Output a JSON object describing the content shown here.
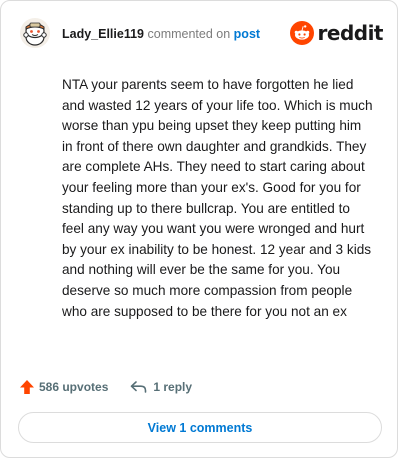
{
  "header": {
    "username": "Lady_Ellie119",
    "action": "commented on",
    "post_link": "post",
    "brand": "reddit",
    "avatar_icon": "snoo-avatar-icon",
    "logo_icon": "reddit-alien-icon"
  },
  "comment": {
    "text": "NTA your parents seem to have forgotten he lied and wasted 12 years of your life too. Which is much worse than ypu being upset they keep putting him in front of there own daughter and grandkids. They are complete AHs. They need to start caring about your feeling more than your ex's. Good for you for standing up to there bullcrap. You are entitled to feel any way you want you were wronged and hurt by your ex inability to be honest. 12 year and 3 kids and nothing will ever be the same for you. You deserve so much more compassion from people who are supposed to be there for you not an ex"
  },
  "footer": {
    "upvotes": "586 upvotes",
    "replies": "1 reply",
    "upvote_icon": "upvote-arrow-icon",
    "reply_icon": "reply-arrow-icon"
  },
  "view_button": {
    "label": "View 1 comments"
  },
  "colors": {
    "brand_orange": "#ff4500",
    "link_blue": "#0079d3",
    "muted": "#7c7c7c"
  }
}
